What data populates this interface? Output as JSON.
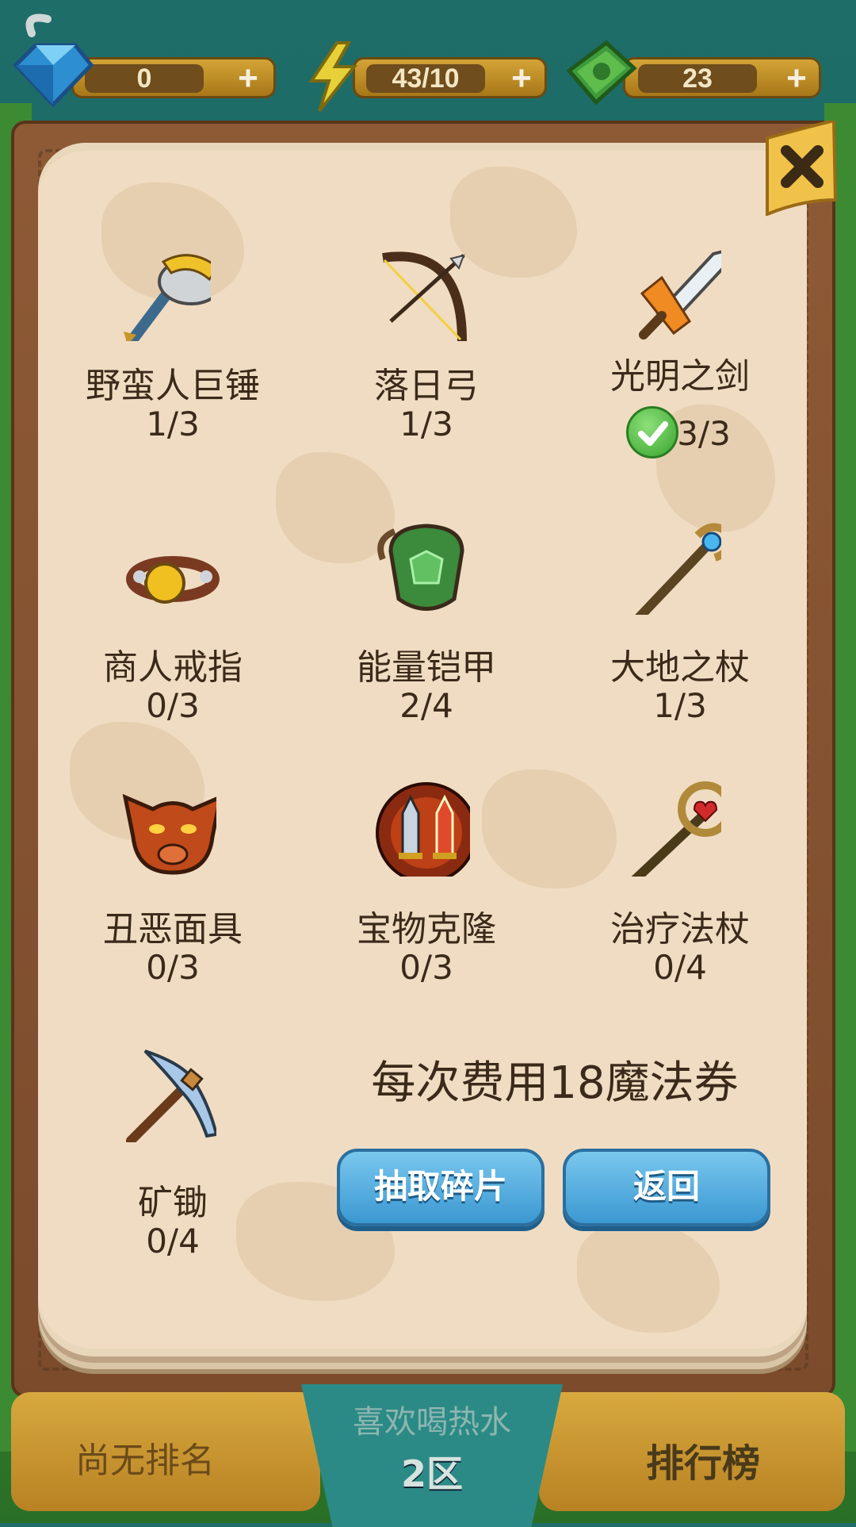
{
  "resources": {
    "gems": {
      "value": "0",
      "icon": "diamond-icon"
    },
    "energy": {
      "value": "43/10",
      "icon": "lightning-icon"
    },
    "cash": {
      "value": "23",
      "icon": "cash-icon"
    },
    "plus_label": "+"
  },
  "items": [
    {
      "name": "野蛮人巨锤",
      "count": "1/3",
      "icon": "hammer-icon"
    },
    {
      "name": "落日弓",
      "count": "1/3",
      "icon": "bow-icon"
    },
    {
      "name": "光明之剑",
      "count": "3/3",
      "icon": "sword-icon",
      "complete": true
    },
    {
      "name": "商人戒指",
      "count": "0/3",
      "icon": "ring-icon"
    },
    {
      "name": "能量铠甲",
      "count": "2/4",
      "icon": "armor-icon"
    },
    {
      "name": "大地之杖",
      "count": "1/3",
      "icon": "staff-icon"
    },
    {
      "name": "丑恶面具",
      "count": "0/3",
      "icon": "mask-icon"
    },
    {
      "name": "宝物克隆",
      "count": "0/3",
      "icon": "clone-icon"
    },
    {
      "name": "治疗法杖",
      "count": "0/4",
      "icon": "heal-staff-icon"
    },
    {
      "name": "矿锄",
      "count": "0/4",
      "icon": "pickaxe-icon"
    }
  ],
  "cost_text": "每次费用18魔法券",
  "buttons": {
    "draw": "抽取碎片",
    "back": "返回"
  },
  "bottom": {
    "rank": "尚无排名",
    "server_name": "喜欢喝热水",
    "server_zone": "2区",
    "leaderboard": "排行榜"
  },
  "colors": {
    "page": "#f0dcc2",
    "frame": "#8e5a36",
    "button": "#4aa6dc",
    "text": "#3b2a1a"
  }
}
